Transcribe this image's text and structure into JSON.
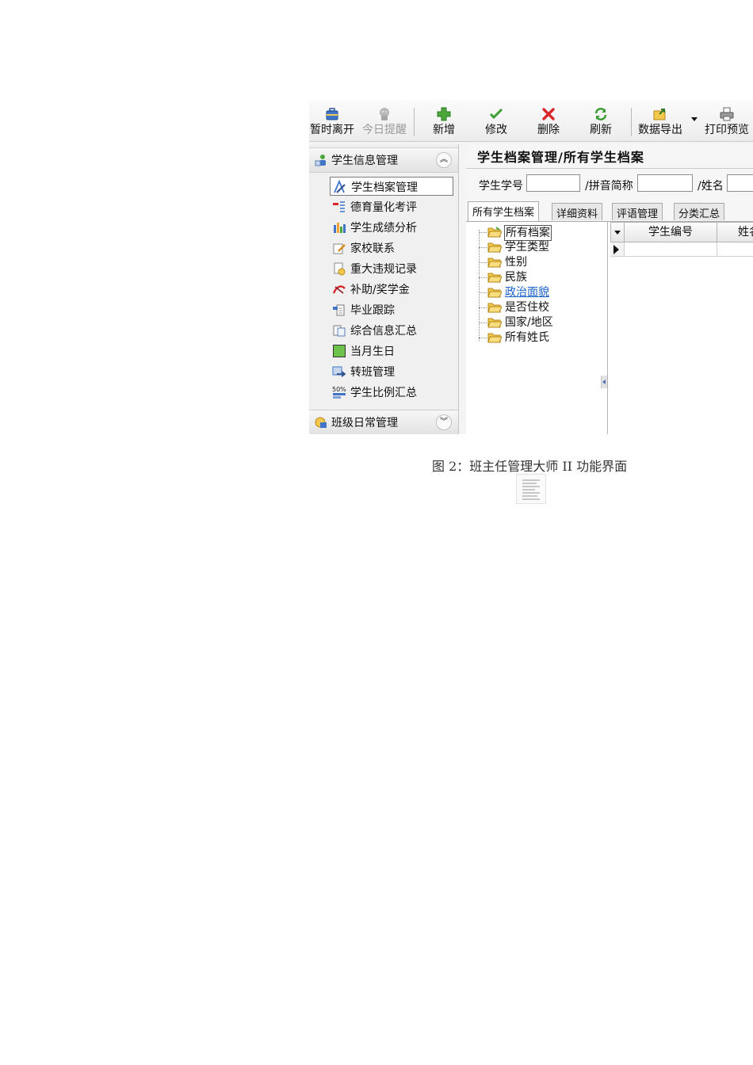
{
  "toolbar": {
    "buttons": [
      {
        "label": "暂时离开",
        "icon": "briefcase-icon",
        "enabled": true
      },
      {
        "label": "今日提醒",
        "icon": "reminder-icon",
        "enabled": false
      },
      {
        "label": "新增",
        "icon": "plus-icon",
        "enabled": true
      },
      {
        "label": "修改",
        "icon": "check-icon",
        "enabled": true
      },
      {
        "label": "删除",
        "icon": "delete-x-icon",
        "enabled": true
      },
      {
        "label": "刷新",
        "icon": "refresh-icon",
        "enabled": true
      },
      {
        "label": "数据导出",
        "icon": "export-icon",
        "enabled": true
      },
      {
        "label": "打印预览",
        "icon": "printer-icon",
        "enabled": true
      }
    ]
  },
  "sidebar": {
    "group1": {
      "label": "学生信息管理",
      "icon": "student-group-icon",
      "expanded": true
    },
    "items": [
      {
        "label": "学生档案管理",
        "icon": "archive-edit-icon",
        "selected": true
      },
      {
        "label": "德育量化考评",
        "icon": "list-score-icon"
      },
      {
        "label": "学生成绩分析",
        "icon": "bar-chart-icon"
      },
      {
        "label": "家校联系",
        "icon": "pen-paper-icon"
      },
      {
        "label": "重大违规记录",
        "icon": "warning-doc-icon"
      },
      {
        "label": "补助/奖学金",
        "icon": "ribbon-icon"
      },
      {
        "label": "毕业跟踪",
        "icon": "track-doc-icon"
      },
      {
        "label": "综合信息汇总",
        "icon": "summary-doc-icon"
      },
      {
        "label": "当月生日",
        "icon": "calendar-green-icon"
      },
      {
        "label": "转班管理",
        "icon": "transfer-icon"
      },
      {
        "label": "学生比例汇总",
        "icon": "percent-icon"
      }
    ],
    "group2": {
      "label": "班级日常管理",
      "icon": "class-daily-icon",
      "expanded": false
    }
  },
  "main": {
    "title": "学生档案管理/所有学生档案",
    "search": {
      "student_no_label": "学生学号",
      "student_no_value": "",
      "pinyin_label": "/拼音简称",
      "pinyin_value": "",
      "name_label": "/姓名",
      "name_value": ""
    },
    "tabs": [
      {
        "label": "所有学生档案",
        "active": true
      },
      {
        "label": "详细资料"
      },
      {
        "label": "评语管理"
      },
      {
        "label": "分类汇总"
      }
    ],
    "tree": [
      {
        "label": "所有档案",
        "selected": true
      },
      {
        "label": "学生类型"
      },
      {
        "label": "性别"
      },
      {
        "label": "民族"
      },
      {
        "label": "政治面貌",
        "link": true
      },
      {
        "label": "是否住校"
      },
      {
        "label": "国家/地区"
      },
      {
        "label": "所有姓氏"
      }
    ],
    "grid": {
      "columns": [
        "学生编号",
        "姓名"
      ]
    }
  },
  "caption": "图 2：班主任管理大师 II 功能界面",
  "colors": {
    "toolbar_bg": "#efefef",
    "link": "#1a62c7",
    "birthday_green": "#6cc24a",
    "delete_red": "#d9262b",
    "add_green": "#4aa83a"
  }
}
